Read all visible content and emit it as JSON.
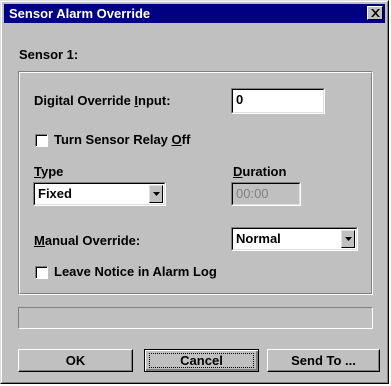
{
  "window": {
    "title": "Sensor Alarm Override"
  },
  "sensor_label": "Sensor 1:",
  "digital_override": {
    "label_pre": "Digital Override ",
    "label_ul": "I",
    "label_post": "nput:",
    "value": "0"
  },
  "turn_relay_off": {
    "label_pre": "Turn Sensor Relay ",
    "label_ul": "O",
    "label_post": "ff",
    "checked": false
  },
  "type": {
    "label_ul": "T",
    "label_post": "ype",
    "selected": "Fixed"
  },
  "duration": {
    "label_ul": "D",
    "label_post": "uration",
    "value": "00:00"
  },
  "manual_override": {
    "label_ul": "M",
    "label_post": "anual Override:",
    "selected": "Normal"
  },
  "leave_notice": {
    "label": "Leave Notice in Alarm Log",
    "checked": false
  },
  "status_text": "",
  "buttons": {
    "ok": "OK",
    "cancel": "Cancel",
    "send_to": "Send To ..."
  },
  "icons": {
    "close": "close-icon",
    "dropdown": "chevron-down-icon"
  }
}
